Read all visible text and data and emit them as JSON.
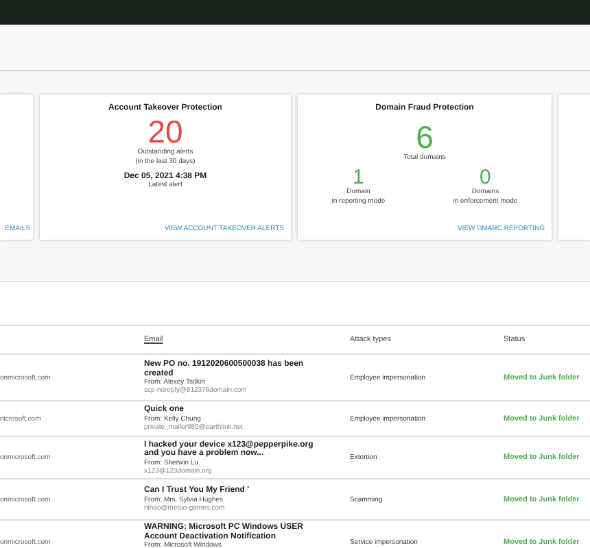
{
  "cards": [
    {
      "kind": "partial",
      "link": "EMAILS"
    },
    {
      "kind": "alerts",
      "title": "Account Takeover Protection",
      "count": "20",
      "count_label": "Outstanding alerts",
      "count_sublabel": "(in the last 30 days)",
      "date": "Dec 05, 2021  4:38 PM",
      "date_label": "Latest alert",
      "link": "VIEW ACCOUNT TAKEOVER ALERTS"
    },
    {
      "kind": "domains",
      "title": "Domain Fraud Protection",
      "total": "6",
      "total_label": "Total domains",
      "stats": [
        {
          "value": "1",
          "label": "Domain",
          "sublabel": "in reporting mode"
        },
        {
          "value": "0",
          "label": "Domains",
          "sublabel": "in enforcement mode"
        }
      ],
      "link": "VIEW DMARC REPORTING"
    },
    {
      "kind": "empty"
    }
  ],
  "table": {
    "columns": [
      "Email",
      "Attack types",
      "Status"
    ],
    "rows": [
      {
        "recipient": "onmicrosoft.com",
        "subject": "New PO no. 1912020600500038 has been created",
        "from": "From: Alexey Tsitkin",
        "address": "scp-noreply@812376domain.com",
        "attack_type": "Employee impersonation",
        "status": "Moved to Junk folder"
      },
      {
        "recipient": "nicrosoft.com",
        "subject": "Quick one",
        "from": "From: Kelly Chung",
        "address": "private_mailer980@earthlink.net",
        "attack_type": "Employee impersonation",
        "status": "Moved to Junk folder"
      },
      {
        "recipient": "onmicrosoft.com",
        "subject": "I hacked your device x123@pepperpike.org and you have a problem now...",
        "from": "From: Sherwin Lu",
        "address": "x123@123domain.org",
        "attack_type": "Extortion",
        "status": "Moved to Junk folder"
      },
      {
        "recipient": "onmicrosoft.com",
        "subject": "Can I Trust You My Friend '",
        "from": "From: Mrs. Sylvia Hughes",
        "address": "nihao@metoo-games.com",
        "attack_type": "Scamming",
        "status": "Moved to Junk folder"
      },
      {
        "recipient": "onmicrosoft.com",
        "subject": "WARNING: Microsoft PC Windows USER Account Deactivation Notification",
        "from": "From: Microsoft Windows",
        "attack_type": "Service impersonation",
        "status": "Moved to Junk folder"
      }
    ]
  }
}
